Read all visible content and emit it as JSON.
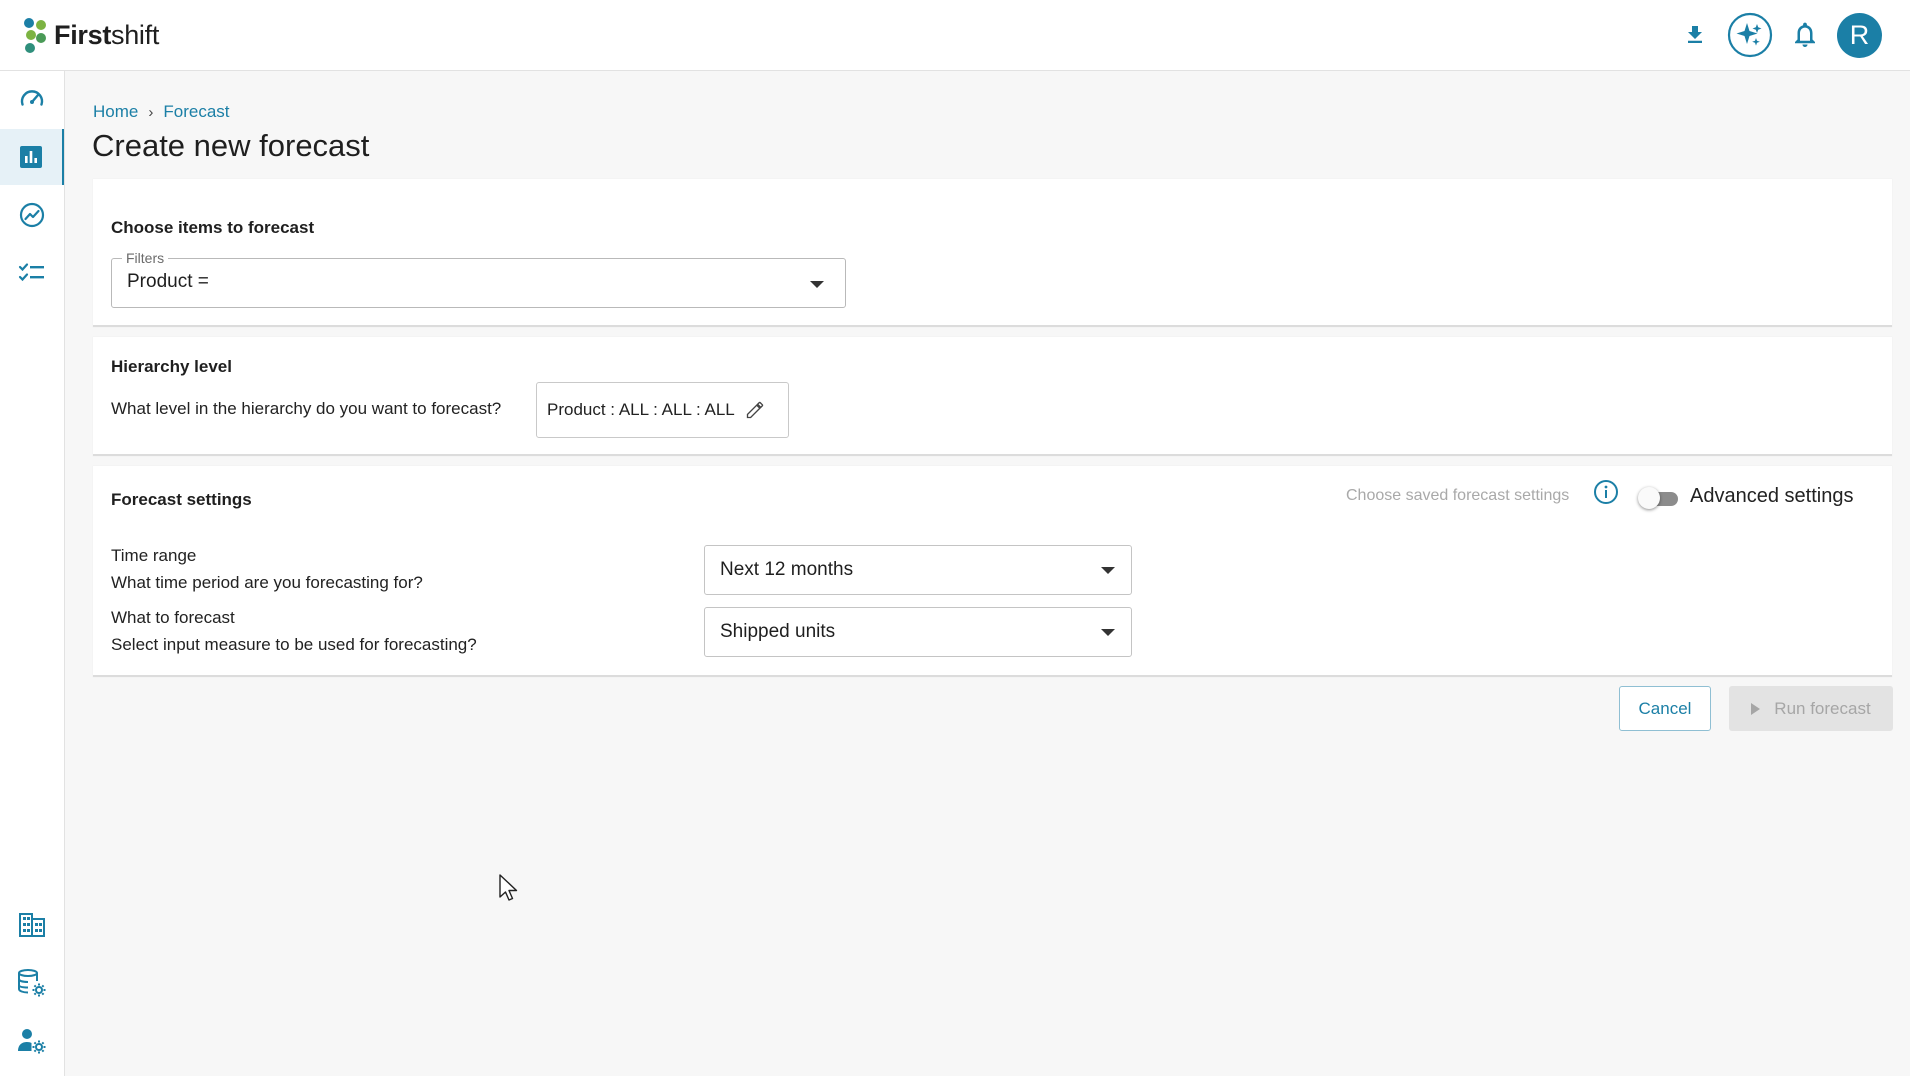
{
  "app": {
    "logo_bold": "First",
    "logo_light": "shift"
  },
  "header": {
    "download_icon": "download-icon",
    "ai_icon": "sparkle-icon",
    "notification_icon": "bell-icon",
    "avatar_letter": "R"
  },
  "sidebar": {
    "top_items": [
      "dashboard-icon",
      "bar-chart-icon",
      "trend-icon",
      "checklist-icon"
    ],
    "bottom_items": [
      "building-icon",
      "database-settings-icon",
      "user-settings-icon"
    ],
    "active_index": 1
  },
  "breadcrumb": {
    "home": "Home",
    "separator": "›",
    "current": "Forecast"
  },
  "page": {
    "title": "Create new forecast"
  },
  "items_card": {
    "title": "Choose items to forecast",
    "filters_label": "Filters",
    "filters_value": "Product ="
  },
  "hierarchy_card": {
    "title": "Hierarchy level",
    "question": "What level in the hierarchy do you want to forecast?",
    "value": "Product : ALL : ALL : ALL"
  },
  "settings_card": {
    "title": "Forecast settings",
    "saved_settings": "Choose saved forecast settings",
    "advanced_label": "Advanced settings",
    "advanced_enabled": false,
    "time_range_label": "Time range",
    "time_range_question": "What time period are you forecasting for?",
    "time_range_value": "Next 12 months",
    "measure_label": "What to forecast",
    "measure_question": "Select input measure to be used for forecasting?",
    "measure_value": "Shipped units"
  },
  "actions": {
    "cancel": "Cancel",
    "run": "Run forecast"
  },
  "colors": {
    "accent": "#1b7fa6",
    "logo_green": "#7cb342",
    "logo_teal": "#1b7fa6"
  }
}
